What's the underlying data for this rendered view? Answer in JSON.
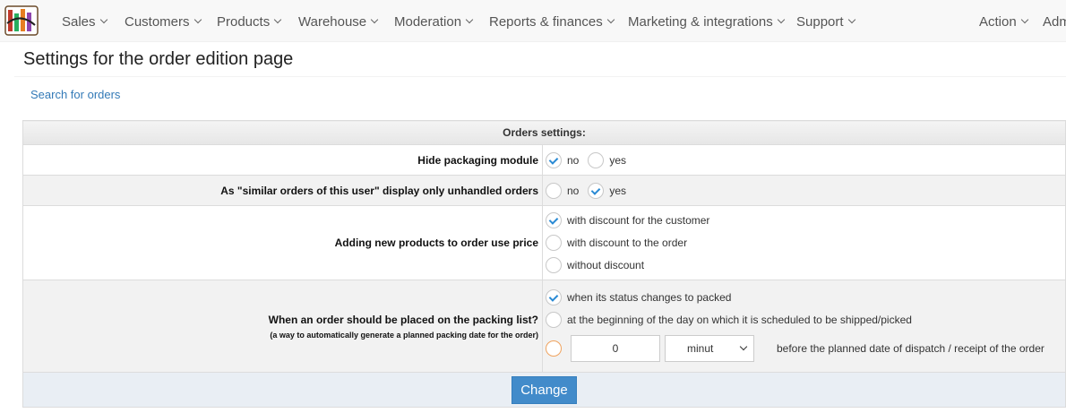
{
  "nav": {
    "items": [
      {
        "label": "Sales"
      },
      {
        "label": "Customers"
      },
      {
        "label": "Products"
      },
      {
        "label": "Warehouse"
      },
      {
        "label": "Moderation"
      },
      {
        "label": "Reports & finances"
      },
      {
        "label": "Marketing & integrations"
      },
      {
        "label": "Support"
      }
    ],
    "action": "Action",
    "admin": "Adm"
  },
  "page": {
    "title": "Settings for the order edition page",
    "search_link": "Search for orders"
  },
  "settings": {
    "header": "Orders settings:",
    "hide_packaging": {
      "label": "Hide packaging module",
      "options": [
        "no",
        "yes"
      ],
      "selected": "no"
    },
    "similar_orders": {
      "label": "As \"similar orders of this user\" display only unhandled orders",
      "options": [
        "no",
        "yes"
      ],
      "selected": "yes"
    },
    "new_products_price": {
      "label": "Adding new products to order use price",
      "options": [
        "with discount for the customer",
        "with discount to the order",
        "without discount"
      ],
      "selected": "with discount for the customer"
    },
    "packing_list": {
      "label": "When an order should be placed on the packing list?",
      "sublabel": "(a way to automatically generate a planned packing date for the order)",
      "options": [
        "when its status changes to packed",
        "at the beginning of the day on which it is scheduled to be shipped/picked"
      ],
      "selected": "when its status changes to packed",
      "amount": "0",
      "unit": "minut",
      "after_text": "before the planned date of dispatch / receipt of the order"
    },
    "submit_label": "Change"
  },
  "colors": {
    "accent": "#428bca",
    "link": "#337ab7",
    "check": "#2a8ad4",
    "custom_radio_border": "#f0a35e"
  }
}
